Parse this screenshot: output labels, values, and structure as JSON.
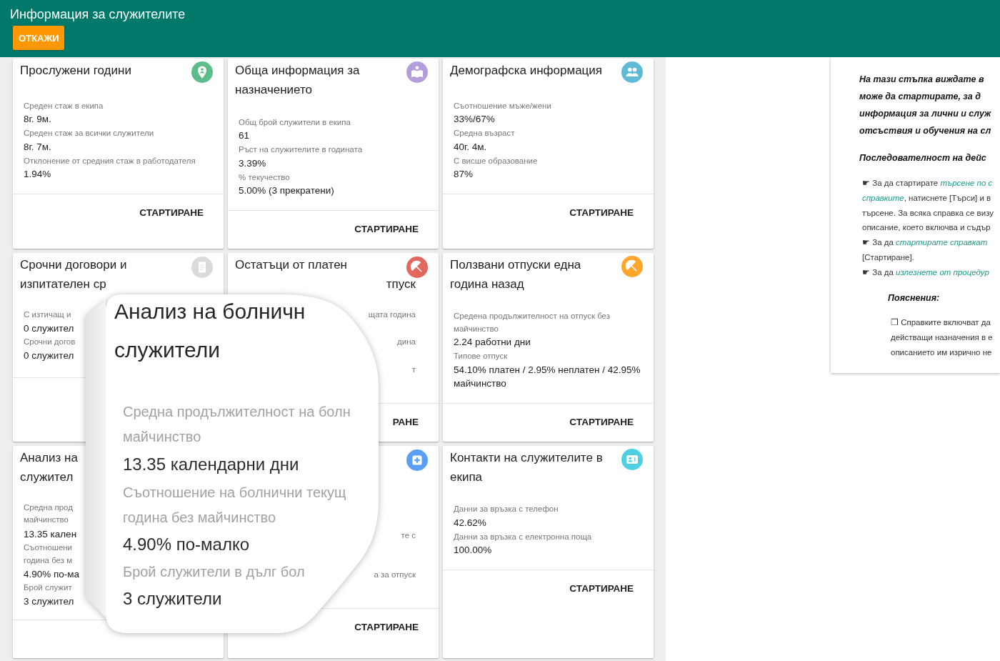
{
  "header": {
    "title": "Информация за служителите",
    "cancel_button": "ОТКАЖИ"
  },
  "cards": [
    {
      "kind": "full",
      "title": "Прослужени години",
      "color": "#5dbd8a",
      "metrics": [
        {
          "label": "Среден стаж в екипа",
          "value": "8г. 9м."
        },
        {
          "label": "Среден стаж за всички служители",
          "value": "8г. 7м."
        },
        {
          "label": "Отклонение от средния стаж в работодателя",
          "value": "1.94%"
        }
      ],
      "action": "СТАРТИРАНЕ"
    },
    {
      "kind": "full",
      "title": "Обща информация за назначението",
      "color": "#b39ddb",
      "metrics": [
        {
          "label": "Общ брой служители в екипа",
          "value": "61"
        },
        {
          "label": "Ръст на служителите в годината",
          "value": "3.39%"
        },
        {
          "label": "% текучество",
          "value": "5.00% (3 прекратени)"
        }
      ],
      "action": "СТАРТИРАНЕ"
    },
    {
      "kind": "full",
      "title": "Демографска информация",
      "color": "#5fbad6",
      "metrics": [
        {
          "label": "Съотношение мъже/жени",
          "value": "33%/67%"
        },
        {
          "label": "Средна възраст",
          "value": "40г. 4м."
        },
        {
          "label": "С висше образование",
          "value": "87%"
        }
      ],
      "action": "СТАРТИРАНЕ"
    },
    {
      "kind": "covered",
      "color": "#dadada",
      "fragments": [
        {
          "kind": "title",
          "text": "Срочни договори и",
          "hidden_start": false
        },
        {
          "kind": "title",
          "text": "изпитателен ср",
          "hidden_start": false
        },
        {
          "kind": "label",
          "text": "С изтичащ и",
          "hidden_start": false
        },
        {
          "kind": "value",
          "text": "0 служител",
          "hidden_start": false
        },
        {
          "kind": "label",
          "text": "Срочни догов",
          "hidden_start": false
        },
        {
          "kind": "value",
          "text": "0 служител",
          "hidden_start": false
        }
      ]
    },
    {
      "kind": "covered",
      "color": "#e2675c",
      "fragments": [
        {
          "kind": "title",
          "text": "Остатъци от платен",
          "hidden_start": false
        },
        {
          "kind": "title",
          "text": "тпуск",
          "hidden_start": true
        },
        {
          "kind": "label",
          "text": "щата година",
          "hidden_start": true
        },
        {
          "kind": "label",
          "text": "дина",
          "hidden_start": true
        },
        {
          "kind": "label",
          "text": "т",
          "hidden_start": true
        }
      ],
      "action": "РАНЕ"
    },
    {
      "kind": "full",
      "title": "Ползвани отпуски една година назад",
      "color": "#ffa62b",
      "metrics": [
        {
          "label": "Средена продължителност на отпуск без майчинство",
          "value": "2.24 работни дни"
        },
        {
          "label": "Типове отпуск",
          "value": "54.10% платен / 2.95% неплатен / 42.95% майчинство"
        }
      ],
      "action": "СТАРТИРАНЕ"
    },
    {
      "kind": "covered",
      "fragments": [
        {
          "kind": "title",
          "text": "Анализ на",
          "hidden_start": false
        },
        {
          "kind": "title",
          "text": "служител",
          "hidden_start": false
        },
        {
          "kind": "label",
          "text": "Средна прод",
          "hidden_start": false
        },
        {
          "kind": "label",
          "text": "майчинство",
          "hidden_start": false
        },
        {
          "kind": "value",
          "text": "13.35 кален",
          "hidden_start": false
        },
        {
          "kind": "label",
          "text": "Съотношени",
          "hidden_start": false
        },
        {
          "kind": "label",
          "text": "година без м",
          "hidden_start": false
        },
        {
          "kind": "value",
          "text": "4.90% по-ма",
          "hidden_start": false
        },
        {
          "kind": "label",
          "text": "Брой служит",
          "hidden_start": false
        },
        {
          "kind": "value",
          "text": "3 служител",
          "hidden_start": false
        }
      ]
    },
    {
      "kind": "covered",
      "color": "#5b9ef2",
      "fragments": [
        {
          "kind": "label",
          "text": "те с",
          "hidden_start": true
        },
        {
          "kind": "label",
          "text": "а за отпуск",
          "hidden_start": true
        }
      ],
      "action": "СТАРТИРАНЕ"
    },
    {
      "kind": "full",
      "title": "Контакти на служителите в екипа",
      "color": "#4dd0e1",
      "metrics": [
        {
          "label": "Данни за връзка с телефон",
          "value": "42.62%"
        },
        {
          "label": "Данни за връзка с електронна поща",
          "value": "100.00%"
        }
      ],
      "action": "СТАРТИРАНЕ"
    }
  ],
  "magnifier": {
    "lines": [
      {
        "kind": "title",
        "text": "Анализ на болничн"
      },
      {
        "kind": "title",
        "text": "служители"
      },
      {
        "kind": "label",
        "text": "Средна продължителност на болн"
      },
      {
        "kind": "label",
        "text": "майчинство"
      },
      {
        "kind": "value",
        "text": "13.35 календарни дни"
      },
      {
        "kind": "label",
        "text": "Съотношение на болнични текущ"
      },
      {
        "kind": "label",
        "text": "година без майчинство"
      },
      {
        "kind": "value",
        "text": "4.90% по-малко"
      },
      {
        "kind": "label",
        "text": "Брой служители в дълг бол"
      },
      {
        "kind": "value",
        "text": "3 служители"
      }
    ]
  },
  "help": {
    "intro_lines": [
      "На тази стъпка виждате в",
      "може да стартирате, за д",
      "информация за лични и служ",
      "отсъствия и обучения на сл"
    ],
    "heading": "Последователност на дейс",
    "step_lines": [
      {
        "segments": [
          {
            "text": "☛ За да стартирате ",
            "link": false
          },
          {
            "text": "търсене по с",
            "link": true
          }
        ]
      },
      {
        "segments": [
          {
            "text": "справките",
            "link": true
          },
          {
            "text": ", натиснете [Търси] и в",
            "link": false
          }
        ]
      },
      {
        "segments": [
          {
            "text": "търсене. За всяка справка се визу",
            "link": false
          }
        ]
      },
      {
        "segments": [
          {
            "text": "описание, което включва и съдър",
            "link": false
          }
        ]
      },
      {
        "segments": [
          {
            "text": "☛ За да ",
            "link": false
          },
          {
            "text": "стартирате справкат",
            "link": true
          }
        ]
      },
      {
        "segments": [
          {
            "text": "[Стартиране].",
            "link": false
          }
        ]
      },
      {
        "segments": [
          {
            "text": "☛ За да ",
            "link": false
          },
          {
            "text": "излезнете от процедур",
            "link": true
          }
        ]
      }
    ],
    "notes_heading": "Пояснения:",
    "note_lines": [
      "❒ Справките включват да",
      "действащи назначения в е",
      "описанието им изрично не"
    ]
  }
}
